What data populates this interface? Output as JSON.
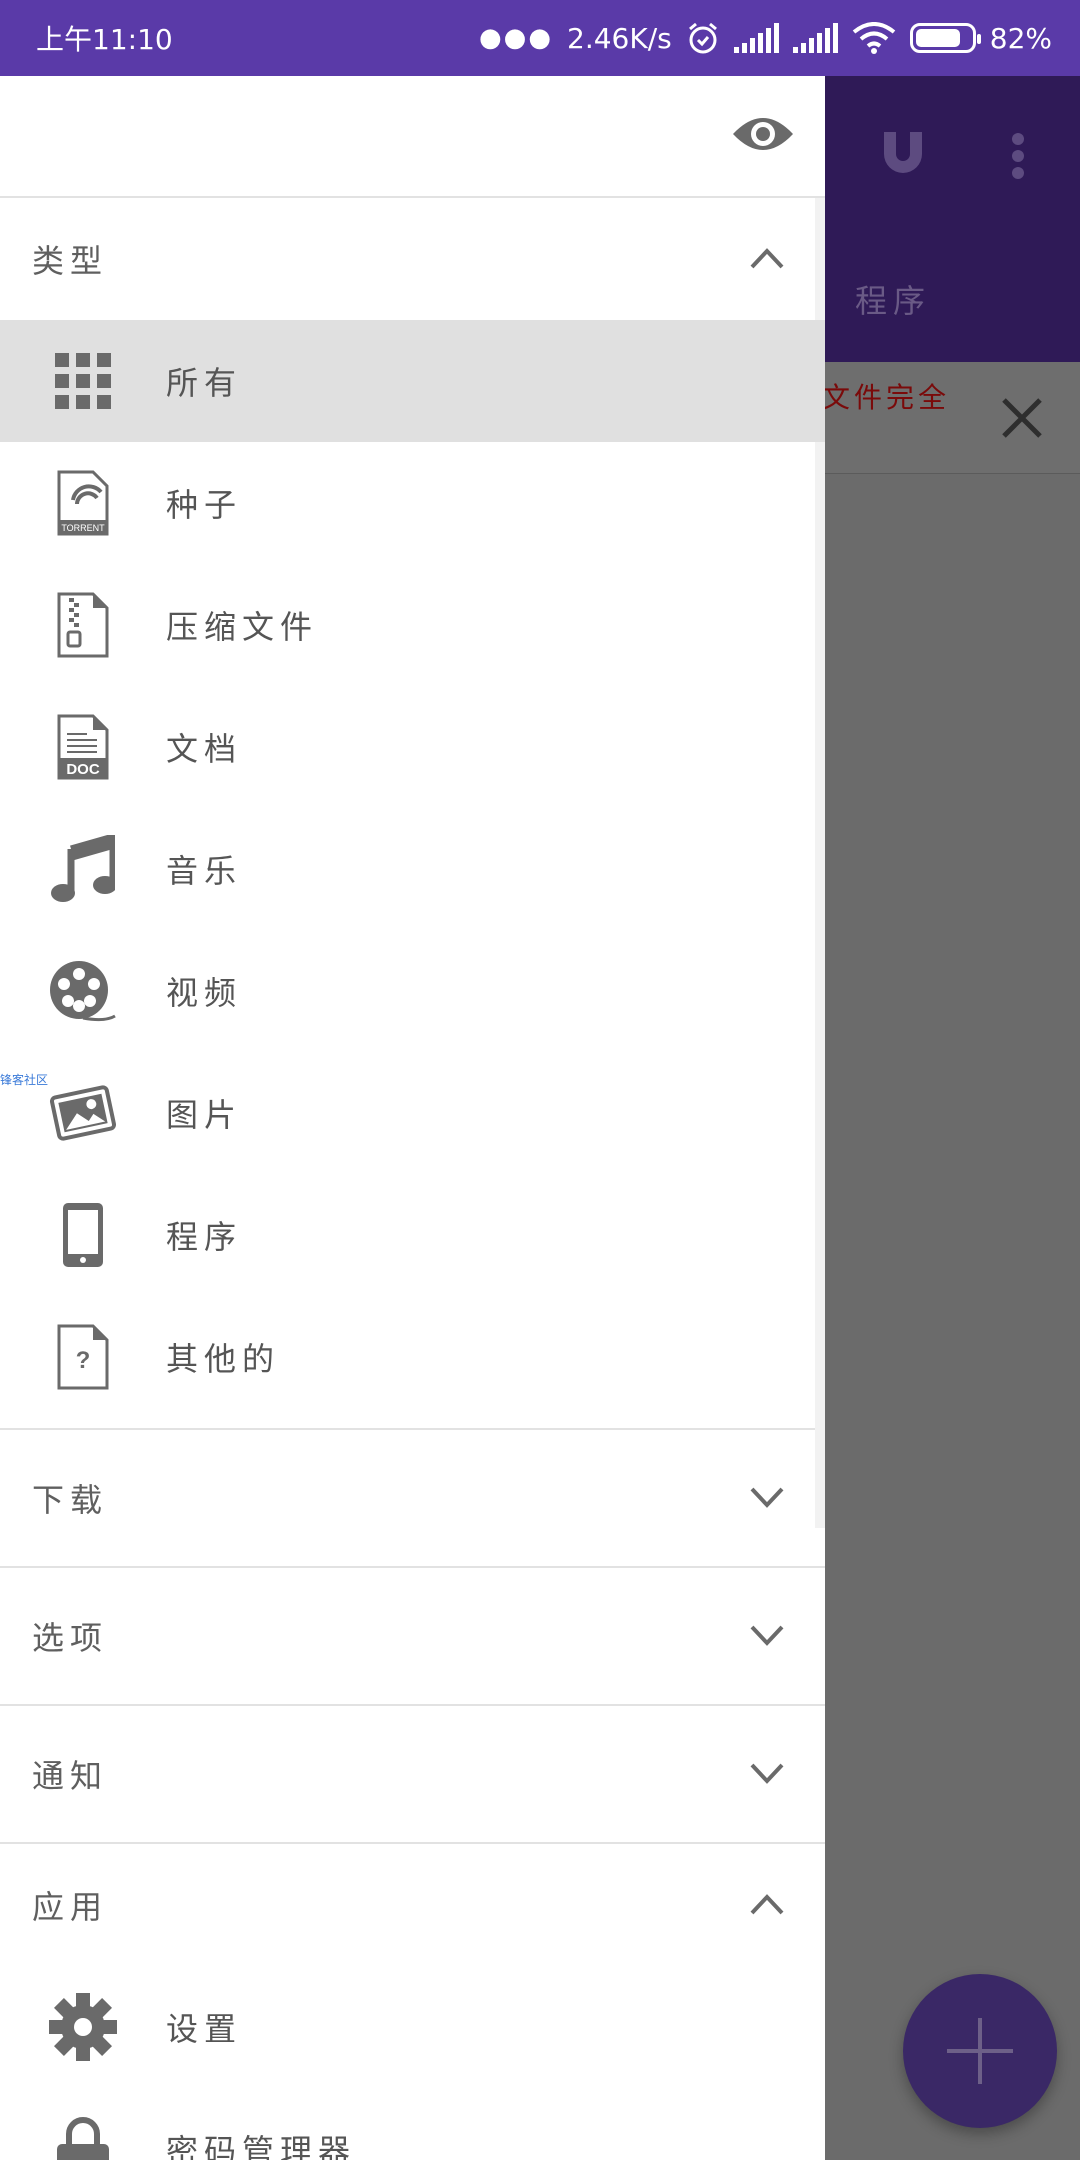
{
  "status_bar": {
    "time": "上午11:10",
    "net_speed": "2.46K/s",
    "battery": "82%",
    "battery_level": 0.82
  },
  "background": {
    "tab_label": "程序",
    "notice_text": "文件完全"
  },
  "drawer": {
    "sections": {
      "type": {
        "title": "类型"
      },
      "download": {
        "title": "下载"
      },
      "options": {
        "title": "选项"
      },
      "notify": {
        "title": "通知"
      },
      "app": {
        "title": "应用"
      }
    },
    "type_items": [
      {
        "label": "所有",
        "icon": "grid-icon"
      },
      {
        "label": "种子",
        "icon": "torrent-file-icon"
      },
      {
        "label": "压缩文件",
        "icon": "zip-file-icon"
      },
      {
        "label": "文档",
        "icon": "doc-file-icon"
      },
      {
        "label": "音乐",
        "icon": "music-note-icon"
      },
      {
        "label": "视频",
        "icon": "film-reel-icon"
      },
      {
        "label": "图片",
        "icon": "photos-icon"
      },
      {
        "label": "程序",
        "icon": "phone-icon"
      },
      {
        "label": "其他的",
        "icon": "unknown-file-icon"
      }
    ],
    "app_items": [
      {
        "label": "设置",
        "icon": "gear-icon"
      },
      {
        "label": "密码管理器",
        "icon": "lock-icon"
      }
    ],
    "watermark": "锋客社区"
  },
  "colors": {
    "status_bar": "#5a3aa8",
    "toolbar": "#2f1a57",
    "icon_gray": "#6a6a6a",
    "selected_bg": "#e0e0e0"
  }
}
